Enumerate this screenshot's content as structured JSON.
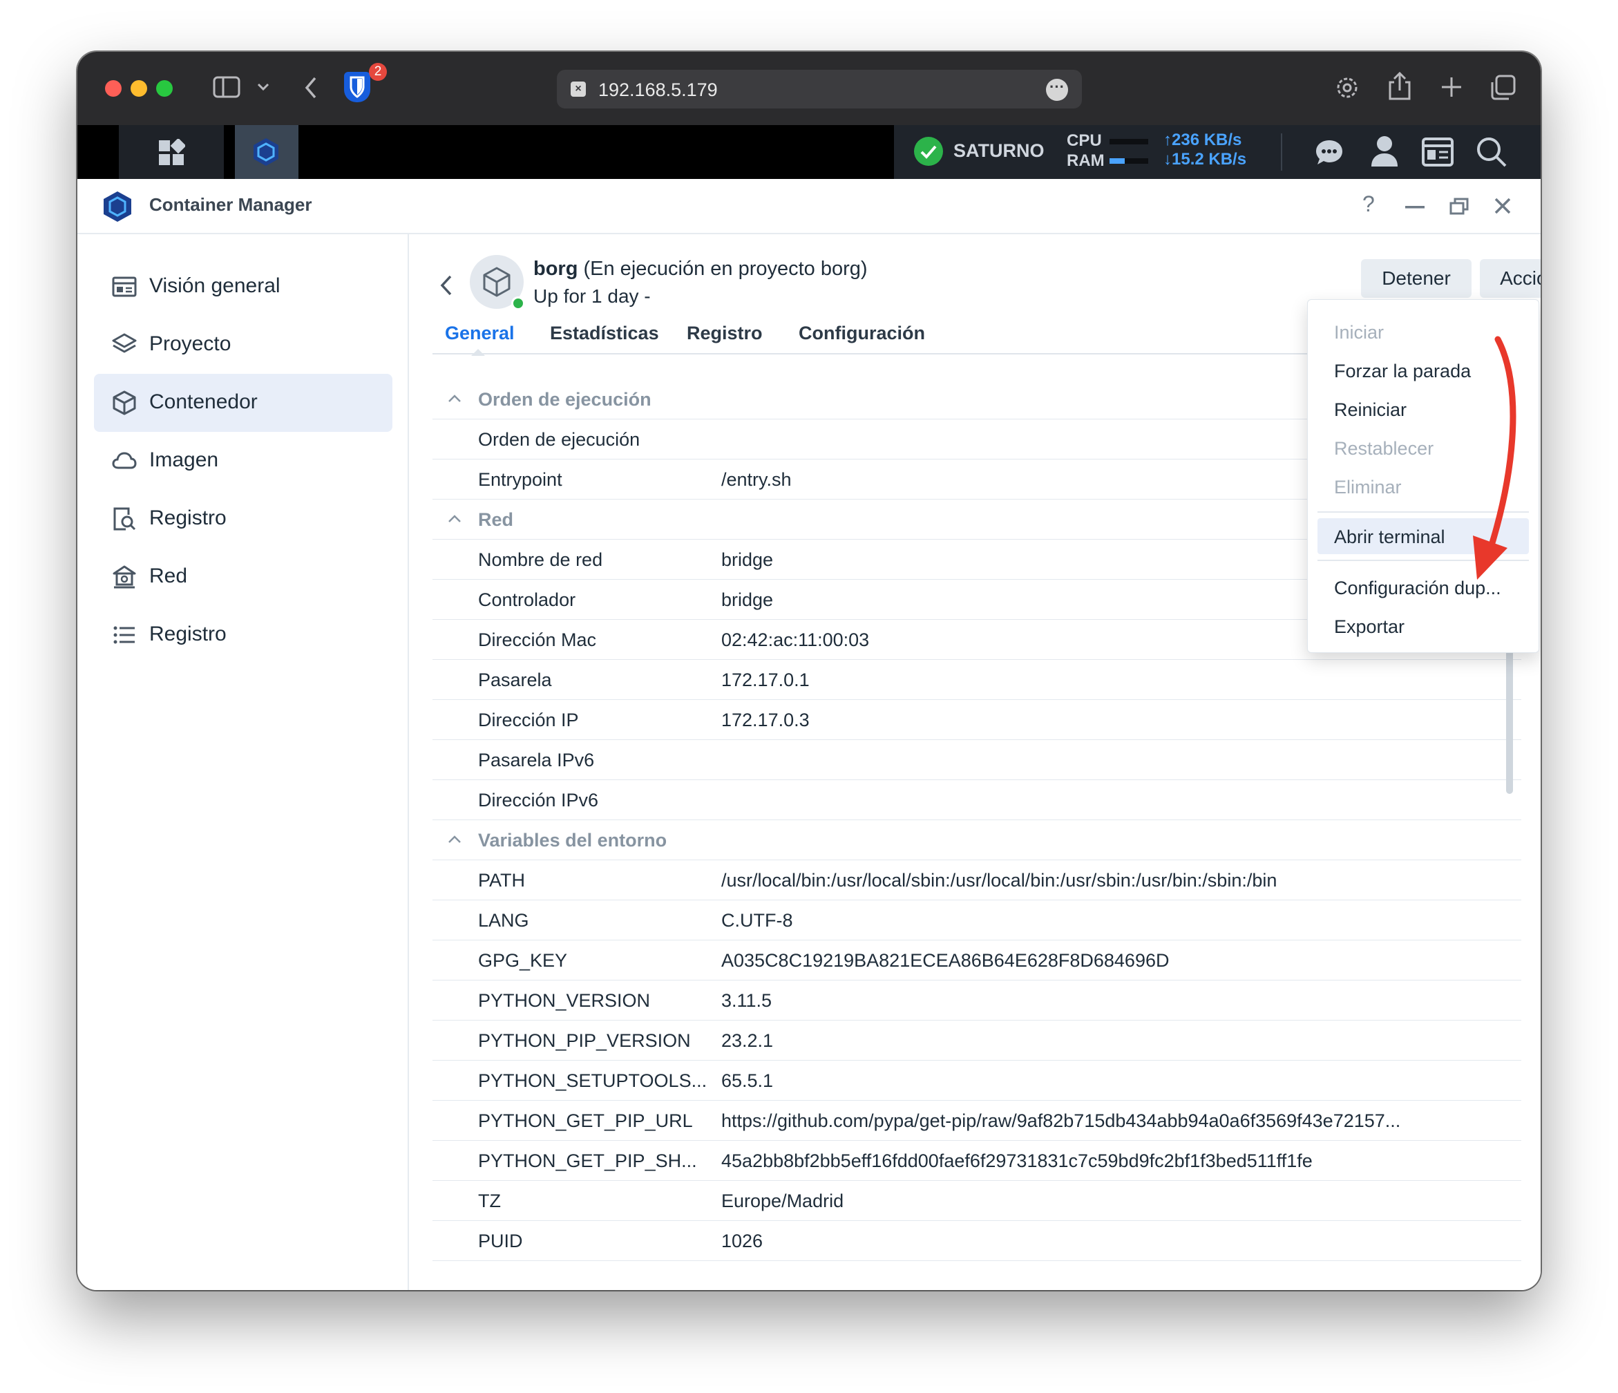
{
  "browser": {
    "url": "192.168.5.179",
    "extension_badge": "2"
  },
  "dsm": {
    "server_name": "SATURNO",
    "cpu_label": "CPU",
    "ram_label": "RAM",
    "cpu_level": 0.0,
    "ram_level": 0.4,
    "upload": "236 KB/s",
    "download": "15.2 KB/s"
  },
  "app": {
    "title": "Container Manager",
    "help": "?"
  },
  "sidebar": {
    "items": [
      {
        "label": "Visión general",
        "icon": "overview-icon"
      },
      {
        "label": "Proyecto",
        "icon": "layers-icon"
      },
      {
        "label": "Contenedor",
        "icon": "cube-icon"
      },
      {
        "label": "Imagen",
        "icon": "cloud-icon"
      },
      {
        "label": "Registro",
        "icon": "registry-search-icon"
      },
      {
        "label": "Red",
        "icon": "network-icon"
      },
      {
        "label": "Registro",
        "icon": "list-icon"
      }
    ]
  },
  "container": {
    "name": "borg",
    "status": "(En ejecución en proyecto borg)",
    "uptime": "Up for 1 day -"
  },
  "buttons": {
    "stop": "Detener",
    "action": "Acción"
  },
  "tabs": [
    "General",
    "Estadísticas",
    "Registro",
    "Configuración"
  ],
  "sections": {
    "exec": {
      "title": "Orden de ejecución",
      "rows": [
        {
          "k": "Orden de ejecución",
          "v": ""
        },
        {
          "k": "Entrypoint",
          "v": "/entry.sh"
        }
      ]
    },
    "network": {
      "title": "Red",
      "rows": [
        {
          "k": "Nombre de red",
          "v": "bridge"
        },
        {
          "k": "Controlador",
          "v": "bridge"
        },
        {
          "k": "Dirección Mac",
          "v": "02:42:ac:11:00:03"
        },
        {
          "k": "Pasarela",
          "v": "172.17.0.1"
        },
        {
          "k": "Dirección IP",
          "v": "172.17.0.3"
        },
        {
          "k": "Pasarela IPv6",
          "v": ""
        },
        {
          "k": "Dirección IPv6",
          "v": ""
        }
      ]
    },
    "env": {
      "title": "Variables del entorno",
      "rows": [
        {
          "k": "PATH",
          "v": "/usr/local/bin:/usr/local/sbin:/usr/local/bin:/usr/sbin:/usr/bin:/sbin:/bin"
        },
        {
          "k": "LANG",
          "v": "C.UTF-8"
        },
        {
          "k": "GPG_KEY",
          "v": "A035C8C19219BA821ECEA86B64E628F8D684696D"
        },
        {
          "k": "PYTHON_VERSION",
          "v": "3.11.5"
        },
        {
          "k": "PYTHON_PIP_VERSION",
          "v": "23.2.1"
        },
        {
          "k": "PYTHON_SETUPTOOLS...",
          "v": "65.5.1"
        },
        {
          "k": "PYTHON_GET_PIP_URL",
          "v": "https://github.com/pypa/get-pip/raw/9af82b715db434abb94a0a6f3569f43e72157..."
        },
        {
          "k": "PYTHON_GET_PIP_SH...",
          "v": "45a2bb8bf2bb5eff16fdd00faef6f29731831c7c59bd9fc2bf1f3bed511ff1fe"
        },
        {
          "k": "TZ",
          "v": "Europe/Madrid"
        },
        {
          "k": "PUID",
          "v": "1026"
        }
      ]
    }
  },
  "action_menu": {
    "items": [
      {
        "label": "Iniciar",
        "enabled": false
      },
      {
        "label": "Forzar la parada",
        "enabled": true
      },
      {
        "label": "Reiniciar",
        "enabled": true
      },
      {
        "label": "Restablecer",
        "enabled": false
      },
      {
        "label": "Eliminar",
        "enabled": false
      },
      {
        "label": "Abrir terminal",
        "enabled": true,
        "highlighted": true
      },
      {
        "label": "Configuración dup...",
        "enabled": true
      },
      {
        "label": "Exportar",
        "enabled": true
      }
    ]
  },
  "colors": {
    "accent": "#1a73e8",
    "running": "#2cb34a",
    "annotation_arrow": "#e8382b",
    "highlight": "#e8eef9"
  }
}
